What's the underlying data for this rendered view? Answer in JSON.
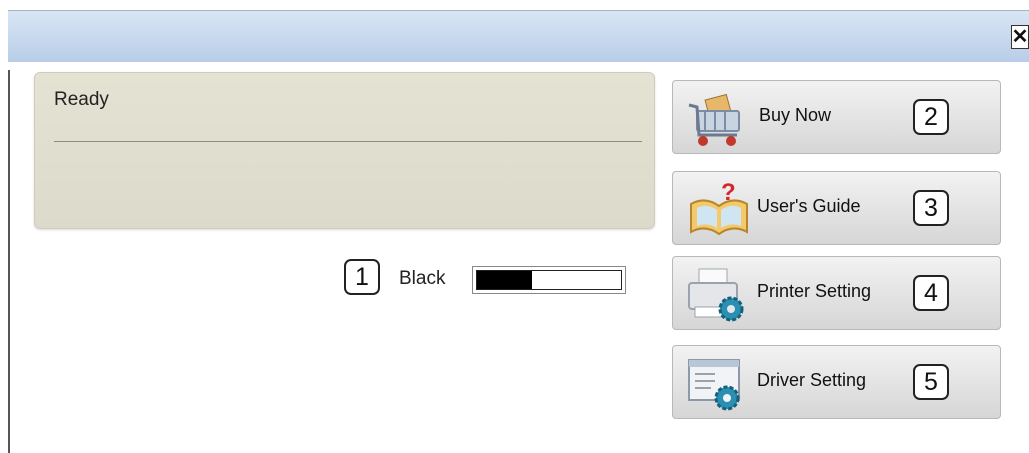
{
  "window": {
    "close_glyph": "✕"
  },
  "status": {
    "text": "Ready"
  },
  "toner": {
    "badge": "1",
    "label": "Black",
    "level_fraction": 0.38,
    "fill_color": "#000000"
  },
  "buttons": [
    {
      "label": "Buy Now",
      "badge": "2",
      "icon": "shopping-cart-icon"
    },
    {
      "label": "User's Guide",
      "badge": "3",
      "icon": "help-book-icon"
    },
    {
      "label": "Printer Setting",
      "badge": "4",
      "icon": "printer-gear-icon"
    },
    {
      "label": "Driver Setting",
      "badge": "5",
      "icon": "window-gear-icon"
    }
  ]
}
